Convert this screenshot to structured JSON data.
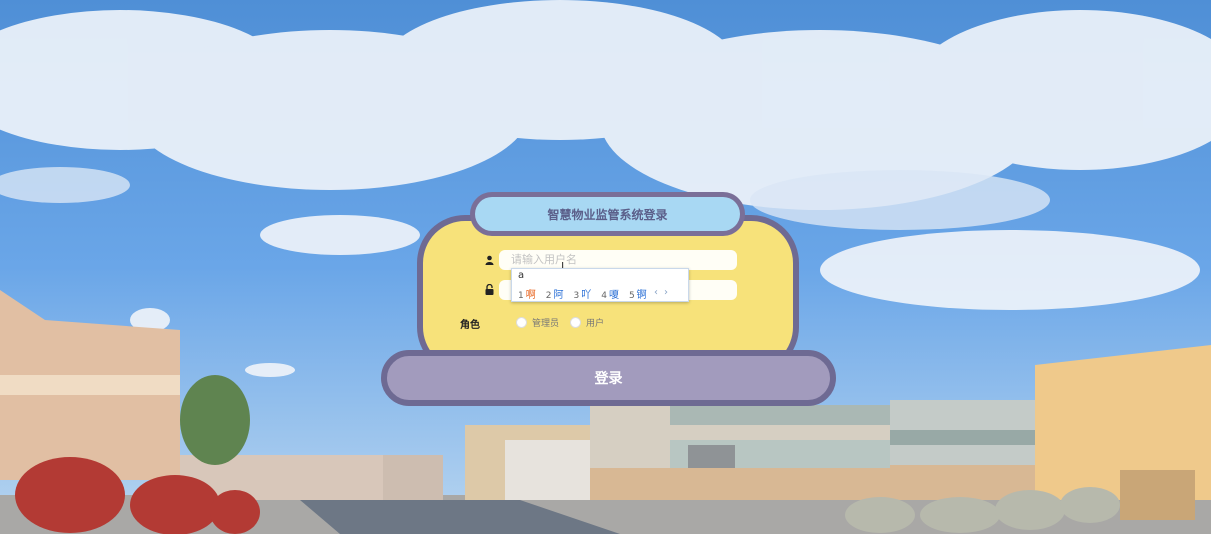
{
  "login": {
    "title": "智慧物业监管系统登录",
    "username_placeholder": "请输入用户名",
    "password_placeholder": "",
    "role_label": "角色",
    "roles": [
      "管理员",
      "用户"
    ],
    "submit_label": "登录"
  },
  "ime": {
    "composition": "a",
    "candidates": [
      {
        "num": "1",
        "word": "啊"
      },
      {
        "num": "2",
        "word": "阿"
      },
      {
        "num": "3",
        "word": "吖"
      },
      {
        "num": "4",
        "word": "嗄"
      },
      {
        "num": "5",
        "word": "锕"
      }
    ],
    "prev": "‹",
    "next": "›"
  },
  "colors": {
    "card": "#f7e27a",
    "border": "#6e6a93",
    "title_bg": "#a8d8f3",
    "button": "#a29bbd"
  }
}
